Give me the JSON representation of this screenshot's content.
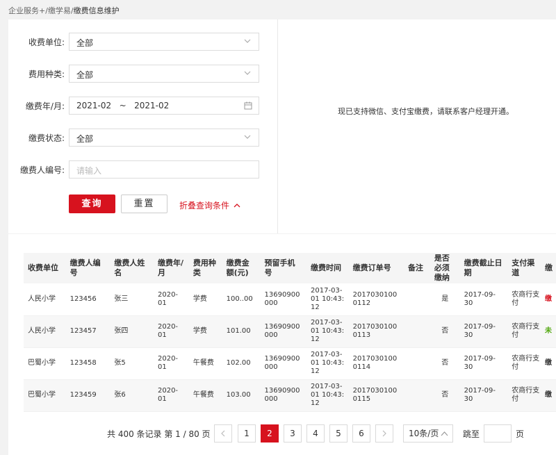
{
  "breadcrumb": {
    "part1": "企业服务+",
    "sep1": "/",
    "part2": "缴学易",
    "sep2": "/",
    "current": "缴费信息维护"
  },
  "filters": {
    "unit_label": "收费单位:",
    "unit_value": "全部",
    "fee_type_label": "费用种类:",
    "fee_type_value": "全部",
    "period_label": "缴费年/月:",
    "period_start": "2021-02",
    "period_sep": "~",
    "period_end": "2021-02",
    "status_label": "缴费状态:",
    "status_value": "全部",
    "payer_no_label": "缴费人编号:",
    "payer_no_placeholder": "请输入"
  },
  "buttons": {
    "query": "查询",
    "reset": "重置",
    "fold": "折叠查询条件"
  },
  "notice": "现已支持微信、支付宝缴费，请联系客户经理开通。",
  "table": {
    "columns": [
      "收费单位",
      "缴费人编号",
      "缴费人姓名",
      "缴费年/月",
      "费用种类",
      "缴费金额(元)",
      "预留手机号",
      "缴费时间",
      "缴费订单号",
      "备注",
      "是否必须缴纳",
      "缴费截止日期",
      "支付渠道",
      "缴"
    ],
    "rows": [
      [
        "人民小学",
        "123456",
        "张三",
        "2020-01",
        "学费",
        "100..00",
        "13690900000",
        "2017-03-01 10:43:12",
        "20170301000112",
        "",
        "是",
        "2017-09-30",
        "农商行支付",
        "缴"
      ],
      [
        "人民小学",
        "123457",
        "张四",
        "2020-01",
        "学费",
        "101.00",
        "13690900000",
        "2017-03-01 10:43:12",
        "20170301000113",
        "",
        "否",
        "2017-09-30",
        "农商行支付",
        "未"
      ],
      [
        "巴蜀小学",
        "123458",
        "张5",
        "2020-01",
        "午餐费",
        "102.00",
        "13690900000",
        "2017-03-01 10:43:12",
        "20170301000114",
        "",
        "否",
        "2017-09-30",
        "农商行支付",
        "缴"
      ],
      [
        "巴蜀小学",
        "123459",
        "张6",
        "2020-01",
        "午餐费",
        "103.00",
        "13690900000",
        "2017-03-01 10:43:12",
        "20170301000115",
        "",
        "否",
        "2017-09-30",
        "农商行支付",
        "缴"
      ]
    ],
    "status_colors": [
      "#d7121e",
      "#52a80f",
      "#333333",
      "#333333"
    ]
  },
  "pagination": {
    "total_text": "共 400 条记录 第 1 / 80 页",
    "pages": [
      "1",
      "2",
      "3",
      "4",
      "5",
      "6"
    ],
    "current": "2",
    "page_size": "10条/页",
    "jump_label": "跳至",
    "page_suffix": "页"
  },
  "colors": {
    "accent": "#d7121e"
  }
}
